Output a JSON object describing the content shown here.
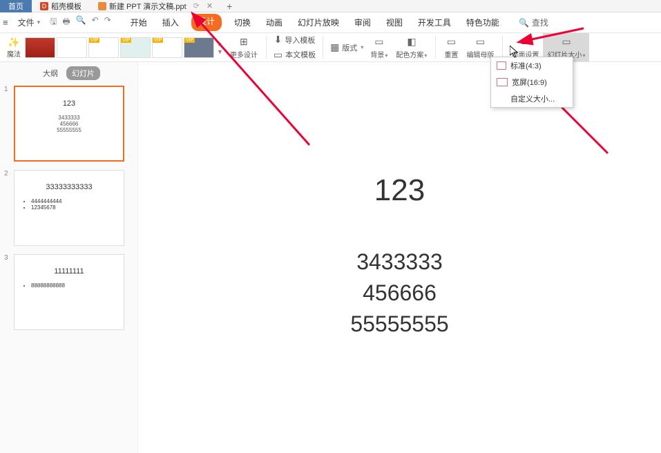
{
  "tabs": {
    "home": "首页",
    "templates": "稻壳模板",
    "doc": "新建 PPT 演示文稿.ppt"
  },
  "menu": {
    "file": "文件",
    "items": [
      "开始",
      "插入",
      "设计",
      "切换",
      "动画",
      "幻灯片放映",
      "审阅",
      "视图",
      "开发工具",
      "特色功能"
    ],
    "active": "设计",
    "search": "查找"
  },
  "ribbon": {
    "magic": "魔法",
    "more": "更多设计",
    "import": "导入模板",
    "this_template": "本文模板",
    "layout": "版式",
    "background": "背景",
    "colors": "配色方案",
    "reset": "重置",
    "edit_master": "编辑母版",
    "page_setup": "页面设置",
    "slide_size": "幻灯片大小"
  },
  "sizemenu": {
    "standard": "标准(4:3)",
    "wide": "宽屏(16:9)",
    "custom": "自定义大小..."
  },
  "panel": {
    "outline": "大纲",
    "slides": "幻灯片"
  },
  "slides": [
    {
      "title": "123",
      "lines": [
        "3433333",
        "456666",
        "55555555"
      ]
    },
    {
      "title": "33333333333",
      "bullets": [
        "4444444444",
        "12345678"
      ]
    },
    {
      "title": "11111111",
      "bullets": [
        "88888888888"
      ]
    }
  ],
  "main": {
    "title": "123",
    "lines": [
      "3433333",
      "456666",
      "55555555"
    ]
  }
}
